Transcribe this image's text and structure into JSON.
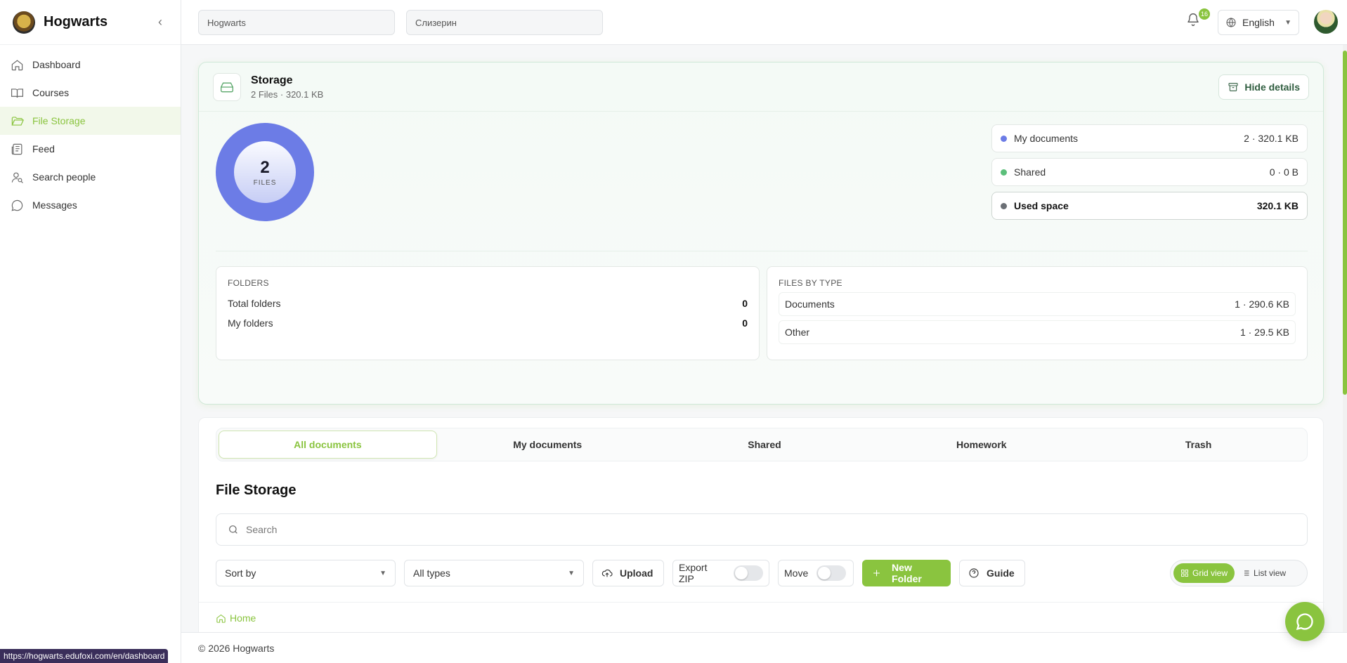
{
  "app": {
    "name": "Hogwarts",
    "collapse_icon": "chevron-left-icon"
  },
  "sidebar": {
    "items": [
      {
        "label": "Dashboard",
        "icon": "home-icon",
        "active": false
      },
      {
        "label": "Courses",
        "icon": "book-icon",
        "active": false
      },
      {
        "label": "File Storage",
        "icon": "folder-open-icon",
        "active": true
      },
      {
        "label": "Feed",
        "icon": "newspaper-icon",
        "active": false
      },
      {
        "label": "Search people",
        "icon": "user-search-icon",
        "active": false
      },
      {
        "label": "Messages",
        "icon": "message-circle-icon",
        "active": false
      }
    ]
  },
  "topbar": {
    "school_select": "Hogwarts",
    "house_select": "Слизерин",
    "notifications_count": "16",
    "language": "English"
  },
  "storage": {
    "title": "Storage",
    "subtitle": "2 Files · 320.1 KB",
    "hide_details_label": "Hide details",
    "donut_count": "2",
    "donut_label": "FILES",
    "legend": [
      {
        "label": "My documents",
        "value": "2 · 320.1 KB",
        "color": "#6c7ce6"
      },
      {
        "label": "Shared",
        "value": "0 · 0 B",
        "color": "#5bbf7a"
      },
      {
        "label": "Used space",
        "value": "320.1 KB",
        "color": "#6b6f75"
      }
    ],
    "folders": {
      "title": "FOLDERS",
      "rows": [
        {
          "label": "Total folders",
          "value": "0"
        },
        {
          "label": "My folders",
          "value": "0"
        }
      ]
    },
    "files_by_type": {
      "title": "FILES BY TYPE",
      "rows": [
        {
          "label": "Documents",
          "value": "1 · 290.6 KB"
        },
        {
          "label": "Other",
          "value": "1 · 29.5 KB"
        }
      ]
    }
  },
  "tabs": [
    "All documents",
    "My documents",
    "Shared",
    "Homework",
    "Trash"
  ],
  "file_storage": {
    "title": "File Storage",
    "search_placeholder": "Search",
    "sort_by": "Sort by",
    "all_types": "All types",
    "upload": "Upload",
    "export_zip": "Export ZIP",
    "move": "Move",
    "new_folder": "New Folder",
    "guide": "Guide",
    "grid_view": "Grid view",
    "list_view": "List view",
    "breadcrumb_home": "Home"
  },
  "footer": {
    "copyright": "© 2026 Hogwarts"
  },
  "status_url": "https://hogwarts.edufoxi.com/en/dashboard",
  "colors": {
    "accent": "#8ac43f",
    "donut": "#6c7ce6"
  }
}
